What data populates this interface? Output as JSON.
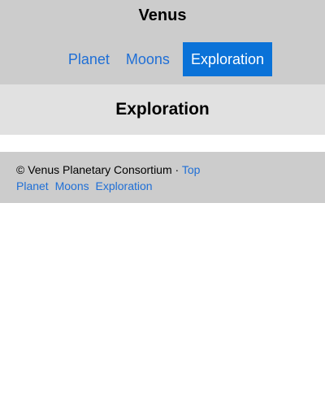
{
  "header": {
    "title": "Venus",
    "nav": [
      {
        "label": "Planet",
        "active": false
      },
      {
        "label": "Moons",
        "active": false
      },
      {
        "label": "Exploration",
        "active": true
      }
    ]
  },
  "main": {
    "section_title": "Exploration"
  },
  "footer": {
    "copyright": "© Venus Planetary Consortium ·",
    "top_link": "Top",
    "links": [
      "Planet",
      "Moons",
      "Exploration"
    ]
  },
  "colors": {
    "header_bg": "#cccccc",
    "section_bg": "#e1e1e1",
    "link": "#1f6fd6",
    "active_bg": "#0a72d8",
    "active_text": "#ffffff"
  }
}
